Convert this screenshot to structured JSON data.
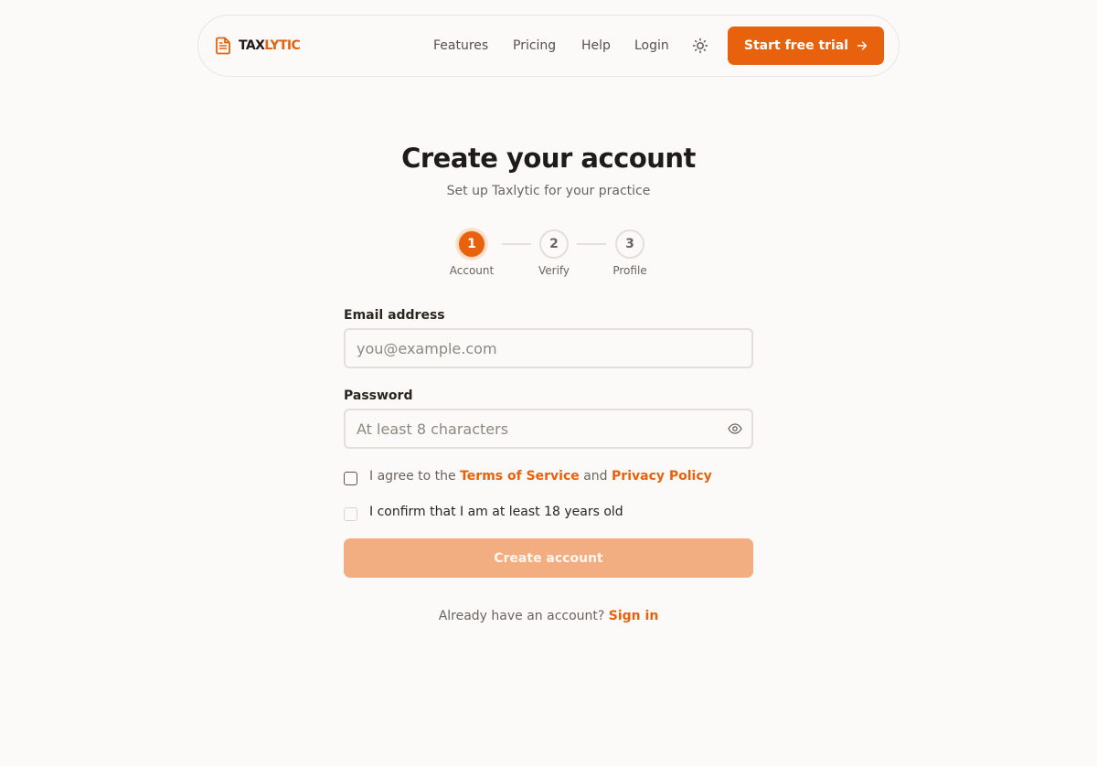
{
  "brand": {
    "name_part1": "TAX",
    "name_part2": "LYTIC",
    "icon": "document-icon"
  },
  "nav": {
    "links": [
      "Features",
      "Pricing",
      "Help",
      "Login"
    ],
    "theme_icon": "sun-icon",
    "cta_label": "Start free trial",
    "cta_icon": "arrow-right-icon"
  },
  "colors": {
    "accent": "#e8610d",
    "accent_disabled": "#f2ad80",
    "background": "#fbfaf8"
  },
  "page": {
    "title": "Create your account",
    "subtitle": "Set up Taxlytic for your practice"
  },
  "stepper": {
    "steps": [
      {
        "number": "1",
        "label": "Account",
        "active": true
      },
      {
        "number": "2",
        "label": "Verify",
        "active": false
      },
      {
        "number": "3",
        "label": "Profile",
        "active": false
      }
    ]
  },
  "form": {
    "email": {
      "label": "Email address",
      "placeholder": "you@example.com",
      "value": ""
    },
    "password": {
      "label": "Password",
      "placeholder": "At least 8 characters",
      "value": "",
      "toggle_icon": "eye-icon"
    },
    "terms": {
      "prefix": "I agree to the ",
      "terms_link": "Terms of Service",
      "middle": " and ",
      "privacy_link": "Privacy Policy",
      "checked": false
    },
    "age": {
      "label": "I confirm that I am at least 18 years old",
      "checked": false
    },
    "submit_label": "Create account",
    "submit_disabled": true
  },
  "footer": {
    "prompt": "Already have an account? ",
    "signin_link": "Sign in"
  }
}
